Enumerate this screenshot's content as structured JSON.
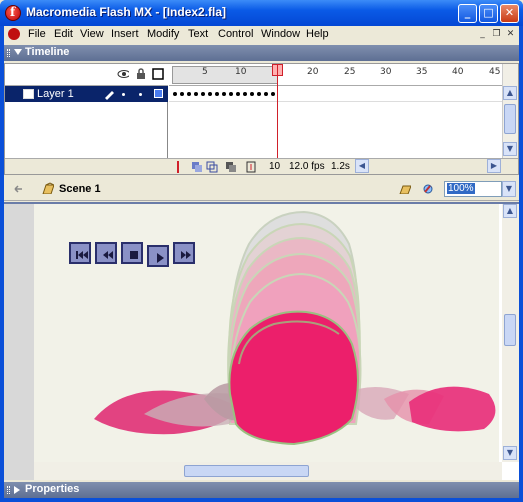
{
  "window": {
    "title": "Macromedia Flash MX - [Index2.fla]",
    "minimize_glyph": "_",
    "maximize_glyph": "□",
    "close_glyph": "✕"
  },
  "menu": {
    "items": [
      "File",
      "Edit",
      "View",
      "Insert",
      "Modify",
      "Text",
      "Control",
      "Window",
      "Help"
    ],
    "mdi_minimize": "_",
    "mdi_restore": "❐",
    "mdi_close": "✕"
  },
  "timeline": {
    "title": "Timeline",
    "layer_name": "Layer 1",
    "ruler_labels": [
      "5",
      "10",
      "15",
      "20",
      "25",
      "30",
      "35",
      "40",
      "45"
    ],
    "current_frame": "10",
    "frame_rate": "12.0 fps",
    "elapsed_time": "1.2s"
  },
  "editbar": {
    "scene_name": "Scene 1",
    "zoom": "100%"
  },
  "properties": {
    "title": "Properties"
  },
  "icons": {
    "eye": "eye-icon",
    "lock": "lock-icon",
    "outline": "outline-icon",
    "pencil": "pencil-icon",
    "add_layer": "add-layer-icon",
    "add_guide": "add-motion-guide-icon",
    "add_folder": "insert-folder-icon",
    "trash": "trash-icon",
    "back_arrow": "back-arrow-icon",
    "scene": "scene-icon",
    "edit_symbol": "edit-symbols-icon",
    "edit_scene": "edit-scene-icon"
  },
  "colors": {
    "titlebar": "#0a5ae6",
    "selected_layer": "#0a246a",
    "playhead": "#d0202a",
    "panel_header": "#6e7fa2",
    "shape_pink": "#ec1f6b"
  }
}
